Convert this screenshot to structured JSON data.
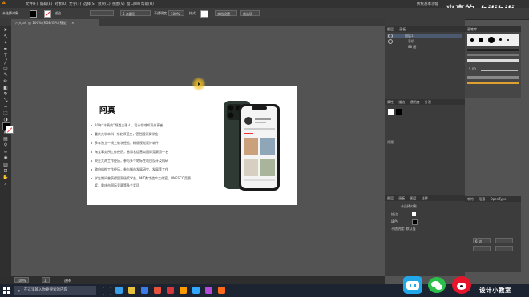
{
  "menubar": {
    "app_logo": "Ai",
    "items": [
      "文件(F)",
      "编辑(E)",
      "对象(O)",
      "文字(T)",
      "选择(S)",
      "效果(C)",
      "视图(V)",
      "窗口(W)",
      "帮助(H)"
    ],
    "right_text": "传统基本功能"
  },
  "control_bar": {
    "mode_label": "未选择对象",
    "stroke_label": "描边",
    "brush_label": "5 点圆形",
    "opacity_label": "不透明度",
    "opacity_value": "100%",
    "style_label": "样式",
    "doc_setup_button": "文档设置",
    "prefs_button": "首选项"
  },
  "document_tab": {
    "label": "*八大.ai* @ 100% (RGB/GPU 预览)",
    "close": "×"
  },
  "artboard": {
    "title": "阿真",
    "bullets": [
      "10年“丰真的”频道主理人，设计领域知识分享者",
      "重庆大学本科+东北师范交，德胜国家奖学金",
      "多年独立一线上教学经验，精通视觉设计软件",
      "淘宝事务所工作经历，曾知名运营商国际竞赛第一名",
      "央企大两工作经历，参与多个地标性项目设计及科研",
      "政府机构工作经历，参与城市发展研究、发展等工作",
      "学生期间曾获得国家级奖学金，MIT数字造产工作室、UNESCO竞赛",
      "奖，重庆市国际竞赛等多个奖项"
    ]
  },
  "layers_panel": {
    "tabs": [
      "图层",
      "画板"
    ],
    "layers": [
      {
        "name": "图层1"
      },
      {
        "name": "手机"
      },
      {
        "name": "88 图"
      }
    ]
  },
  "panels": {
    "tabs_a": [
      "属性",
      "描边",
      "透明度",
      "外观"
    ],
    "appearance_label": "外观",
    "tabs_b": [
      "图层",
      "画板",
      "图层",
      "注释"
    ],
    "layer_rows": [
      "未选择对象",
      "描边",
      "填色"
    ],
    "opacity_row": "不透明度: 默认值",
    "character_tabs": [
      "字符",
      "段落",
      "OpenType"
    ],
    "font_size": "6 pt"
  },
  "brushes_panel": {
    "title": "画笔库",
    "size_label": "5.00"
  },
  "statusbar": {
    "zoom": "100%",
    "page": "1",
    "tool": "选择"
  },
  "taskbar": {
    "search_placeholder": "在这里输入你要搜索的内容",
    "brand_text": "设计小教室"
  },
  "watermark": {
    "logo_text": "来真的",
    "bilibili": "bilibili"
  }
}
